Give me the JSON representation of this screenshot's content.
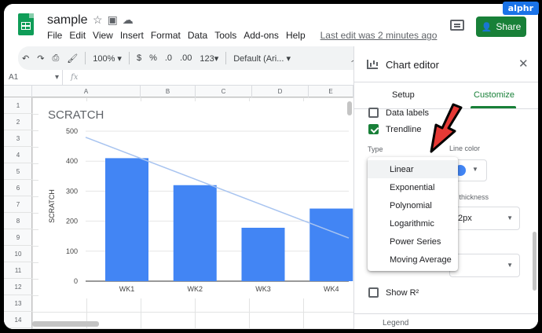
{
  "badge": "alphr",
  "header": {
    "doc_title": "sample",
    "menu": [
      "File",
      "Edit",
      "View",
      "Insert",
      "Format",
      "Data",
      "Tools",
      "Add-ons",
      "Help"
    ],
    "last_edit": "Last edit was 2 minutes ago",
    "share_label": "Share"
  },
  "toolbar": {
    "zoom": "100%",
    "currency": "$",
    "percent": "%",
    "dec_less": ".0",
    "dec_more": ".00",
    "format_more": "123",
    "font": "Default (Ari...",
    "caret": "▾"
  },
  "formula_bar": {
    "cell_ref": "A1",
    "fx": "fx"
  },
  "grid": {
    "columns": [
      "A",
      "B",
      "C",
      "D",
      "E"
    ],
    "rows": [
      "1",
      "2",
      "3",
      "4",
      "5",
      "6",
      "7",
      "8",
      "9",
      "10",
      "11",
      "12",
      "13",
      "14"
    ]
  },
  "chart_data": {
    "type": "bar",
    "title": "SCRATCH",
    "ylabel": "SCRATCH",
    "xlabel": "",
    "categories": [
      "WK1",
      "WK2",
      "WK3",
      "WK4"
    ],
    "values": [
      410,
      320,
      178,
      242
    ],
    "ylim": [
      0,
      500
    ],
    "yticks": [
      0,
      100,
      200,
      300,
      400,
      500
    ],
    "bar_color": "#4285f4",
    "trendline": {
      "type": "linear",
      "color": "#a8c4f0",
      "start": 427,
      "slope": -87
    },
    "grid": true
  },
  "editor": {
    "title": "Chart editor",
    "tabs": {
      "setup": "Setup",
      "customize": "Customize"
    },
    "data_labels": "Data labels",
    "trendline": "Trendline",
    "type_label": "Type",
    "line_color_label": "Line color",
    "thickness_label": "ne thickness",
    "thickness_value": "2px",
    "show_r2": "Show R²",
    "legend_partial": "Legend",
    "type_options": [
      "Linear",
      "Exponential",
      "Polynomial",
      "Logarithmic",
      "Power Series",
      "Moving Average"
    ],
    "line_color": "#4285f4",
    "accent_color": "#188038"
  }
}
